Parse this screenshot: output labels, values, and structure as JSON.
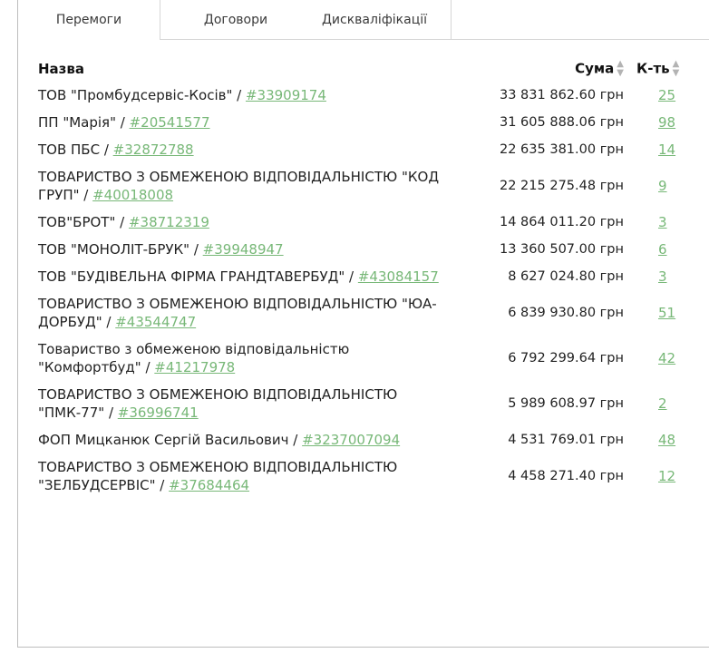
{
  "tabs": [
    {
      "label": "Перемоги"
    },
    {
      "label": "Договори"
    },
    {
      "label": "Дискваліфікації"
    }
  ],
  "table": {
    "headers": {
      "name": "Назва",
      "sum": "Сума",
      "count": "К-ть"
    },
    "rows": [
      {
        "name": "ТОВ \"Промбудсервіс-Косів\"",
        "code": "#33909174",
        "sum": "33 831 862.60 грн",
        "count": "25"
      },
      {
        "name": "ПП \"Марія\"",
        "code": "#20541577",
        "sum": "31 605 888.06 грн",
        "count": "98"
      },
      {
        "name": "ТОВ ПБС",
        "code": "#32872788",
        "sum": "22 635 381.00 грн",
        "count": "14"
      },
      {
        "name": "ТОВАРИСТВО З ОБМЕЖЕНОЮ ВІДПОВІДАЛЬНІСТЮ \"КОД ГРУП\"",
        "code": "#40018008",
        "sum": "22 215 275.48 грн",
        "count": "9"
      },
      {
        "name": "ТОВ\"БРОТ\"",
        "code": "#38712319",
        "sum": "14 864 011.20 грн",
        "count": "3"
      },
      {
        "name": "ТОВ \"МОНОЛІТ-БРУК\"",
        "code": "#39948947",
        "sum": "13 360 507.00 грн",
        "count": "6"
      },
      {
        "name": "ТОВ \"БУДІВЕЛЬНА ФІРМА ГРАНДТАВЕРБУД\"",
        "code": "#43084157",
        "sum": "8 627 024.80 грн",
        "count": "3"
      },
      {
        "name": "ТОВАРИСТВО З ОБМЕЖЕНОЮ ВІДПОВІДАЛЬНІСТЮ \"ЮА-ДОРБУД\"",
        "code": "#43544747",
        "sum": "6 839 930.80 грн",
        "count": "51"
      },
      {
        "name": "Товариство з обмеженою відповідальністю \"Комфортбуд\"",
        "code": "#41217978",
        "sum": "6 792 299.64 грн",
        "count": "42"
      },
      {
        "name": "ТОВАРИСТВО З ОБМЕЖЕНОЮ ВІДПОВІДАЛЬНІСТЮ \"ПМК-77\"",
        "code": "#36996741",
        "sum": "5 989 608.97 грн",
        "count": "2"
      },
      {
        "name": "ФОП Мицканюк Сергій Васильович",
        "code": "#3237007094",
        "sum": "4 531 769.01 грн",
        "count": "48"
      },
      {
        "name": "ТОВАРИСТВО З ОБМЕЖЕНОЮ ВІДПОВІДАЛЬНІСТЮ \"ЗЕЛБУДСЕРВІС\"",
        "code": "#37684464",
        "sum": "4 458 271.40 грн",
        "count": "12"
      }
    ]
  },
  "colors": {
    "link": "#78b878",
    "border": "#d6d6d6",
    "text": "#222222"
  },
  "icons": {
    "sort": "sort-arrows-icon"
  }
}
